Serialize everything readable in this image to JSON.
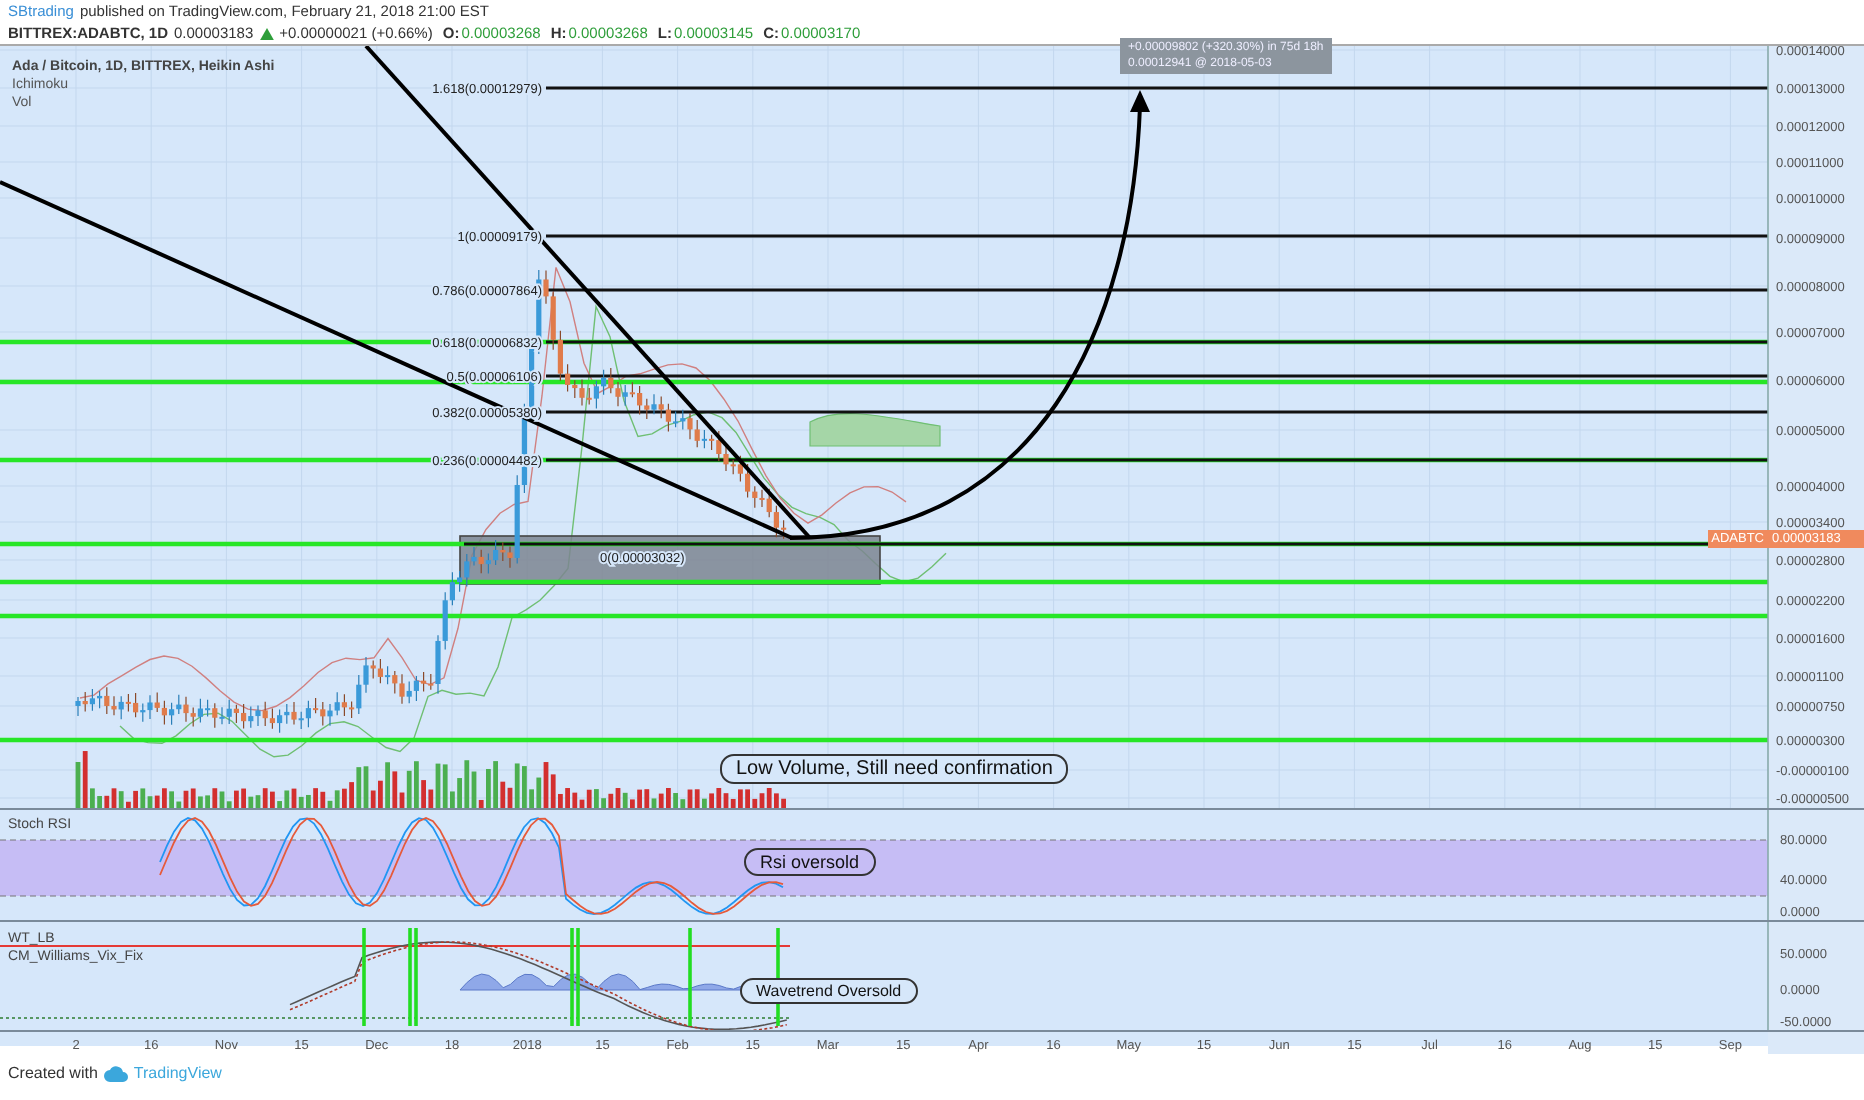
{
  "header": {
    "author": "SBtrading",
    "published": "published on TradingView.com, February 21, 2018 21:00 EST"
  },
  "quote": {
    "symbol": "BITTREX:ADABTC, 1D",
    "price": "0.00003183",
    "change": "+0.00000021 (+0.66%)",
    "ohlc": [
      {
        "label": "O:",
        "value": "0.00003268"
      },
      {
        "label": "H:",
        "value": "0.00003268"
      },
      {
        "label": "L:",
        "value": "0.00003145"
      },
      {
        "label": "C:",
        "value": "0.00003170"
      }
    ]
  },
  "main_pane": {
    "title": "Ada / Bitcoin, 1D, BITTREX, Heikin Ashi",
    "studies": [
      "Ichimoku",
      "Vol"
    ],
    "price_scale": [
      "0.00014000",
      "0.00013000",
      "0.00012000",
      "0.00011000",
      "0.00010000",
      "0.00009000",
      "0.00008000",
      "0.00007000",
      "0.00006000",
      "0.00005000",
      "0.00004000",
      "0.00003400",
      "0.00002800",
      "0.00002200",
      "0.00001600",
      "0.00001100",
      "0.00000750",
      "0.00000300",
      "-0.00000100",
      "-0.00000500"
    ],
    "last_price": {
      "symbol": "ADABTC",
      "value": "0.00003183"
    },
    "fib_levels": [
      "1.618(0.00012979)",
      "1(0.00009179)",
      "0.786(0.00007864)",
      "0.618(0.00006832)",
      "0.5(0.00006106)",
      "0.382(0.00005380)",
      "0.236(0.00004482)",
      "0(0.00003032)"
    ],
    "projection_label": [
      "+0.00009802 (+320.30%) in 75d 18h",
      "0.00012941 @ 2018-05-03"
    ],
    "note": "Low Volume, Still need confirmation"
  },
  "stoch_pane": {
    "title": "Stoch RSI",
    "scale": [
      "80.0000",
      "40.0000",
      "0.0000"
    ],
    "note": "Rsi oversold"
  },
  "wt_pane": {
    "titles": [
      "WT_LB",
      "CM_Williams_Vix_Fix"
    ],
    "scale": [
      "50.0000",
      "0.0000",
      "-50.0000"
    ],
    "note": "Wavetrend Oversold"
  },
  "time_scale": [
    "2",
    "16",
    "Nov",
    "15",
    "Dec",
    "18",
    "2018",
    "15",
    "Feb",
    "15",
    "Mar",
    "15",
    "Apr",
    "16",
    "May",
    "15",
    "Jun",
    "15",
    "Jul",
    "16",
    "Aug",
    "15",
    "Sep"
  ],
  "footer": {
    "created": "Created with",
    "brand": "TradingView"
  }
}
